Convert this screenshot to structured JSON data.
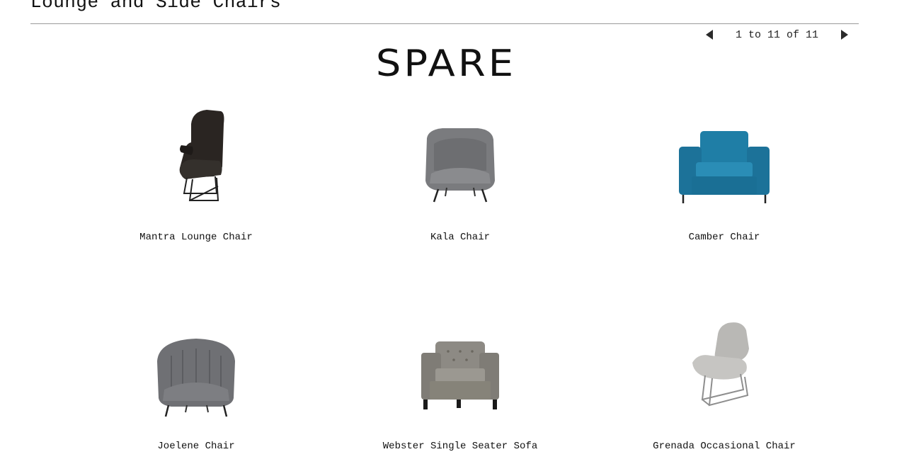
{
  "header": {
    "category_title": "Lounge and Side Chairs"
  },
  "pager": {
    "count_text": "1 to 11 of 11",
    "prev_icon": "triangle-left-icon",
    "next_icon": "triangle-right-icon"
  },
  "brand": {
    "logo_text": "SPARE"
  },
  "products": [
    {
      "name": "Mantra Lounge Chair",
      "image": "dark-wingback-lounge-chair",
      "color": "#2a2522"
    },
    {
      "name": "Kala Chair",
      "image": "grey-tub-chair",
      "color": "#7a7b7e"
    },
    {
      "name": "Camber Chair",
      "image": "teal-armchair",
      "color": "#1f7ea6"
    },
    {
      "name": "Joelene Chair",
      "image": "grey-channel-tub-chair",
      "color": "#6f7074"
    },
    {
      "name": "Webster Single Seater Sofa",
      "image": "grey-tufted-armchair",
      "color": "#8d8a84"
    },
    {
      "name": "Grenada Occasional Chair",
      "image": "light-grey-lounge-chair",
      "color": "#b9b8b5"
    }
  ]
}
